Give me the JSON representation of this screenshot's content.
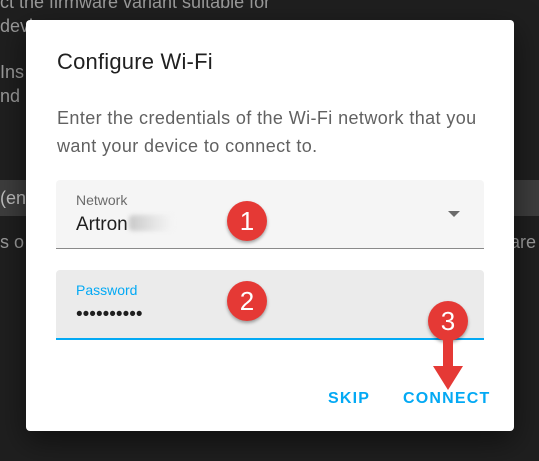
{
  "background": {
    "line1": "ct the firmware variant suitable for",
    "line2": "device.",
    "line3": "Ins",
    "line4": "nd",
    "select_text": "(en",
    "line5": "s o",
    "line5_right": "are"
  },
  "dialog": {
    "title": "Configure Wi-Fi",
    "description": "Enter the credentials of the Wi-Fi network that you want your device to connect to.",
    "network": {
      "label": "Network",
      "value": "Artron",
      "icon": "chevron-down-icon"
    },
    "password": {
      "label": "Password",
      "value": "••••••••••"
    },
    "actions": {
      "skip_label": "SKIP",
      "connect_label": "CONNECT"
    },
    "accent_color": "#03a9f4"
  },
  "annotations": {
    "step1": "1",
    "step2": "2",
    "step3": "3",
    "color": "#e53935"
  }
}
